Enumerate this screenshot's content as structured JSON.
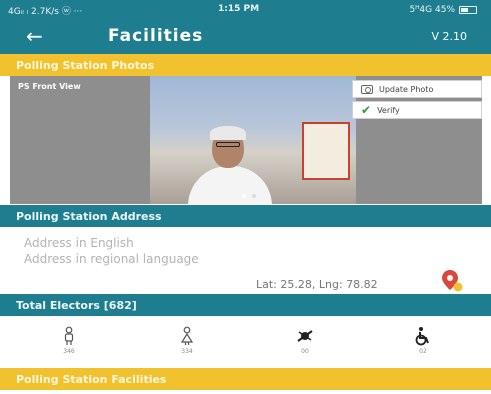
{
  "status_bar": {
    "left": "4Gᵢₗ ₗ 2.7K/s ⓦ ···",
    "time": "1:15 PM",
    "right": "5ᴴ4G 45%"
  },
  "app_bar": {
    "title": "Facilities",
    "version": "V 2.10",
    "back_icon": "back-arrow-icon"
  },
  "photos_section": {
    "header": "Polling Station Photos",
    "photo_label": "PS Front View",
    "update_label": "Update Photo",
    "verify_label": "Verify"
  },
  "address_section": {
    "header": "Polling Station Address",
    "english_placeholder": "Address in English",
    "regional_placeholder": "Address in regional language",
    "latlng": "Lat: 25.28, Lng: 78.82"
  },
  "electors_section": {
    "header": "Total Electors [682]",
    "items": [
      {
        "icon": "male-icon",
        "count": "346"
      },
      {
        "icon": "female-icon",
        "count": "334"
      },
      {
        "icon": "third-gender-icon",
        "count": "00"
      },
      {
        "icon": "wheelchair-icon",
        "count": "02"
      }
    ]
  },
  "facilities_section": {
    "header": "Polling Station Facilities"
  },
  "colors": {
    "teal": "#1e7d8f",
    "yellow": "#f2c12e",
    "verify_green": "#2c9c3f",
    "pin_red": "#d9483b"
  }
}
